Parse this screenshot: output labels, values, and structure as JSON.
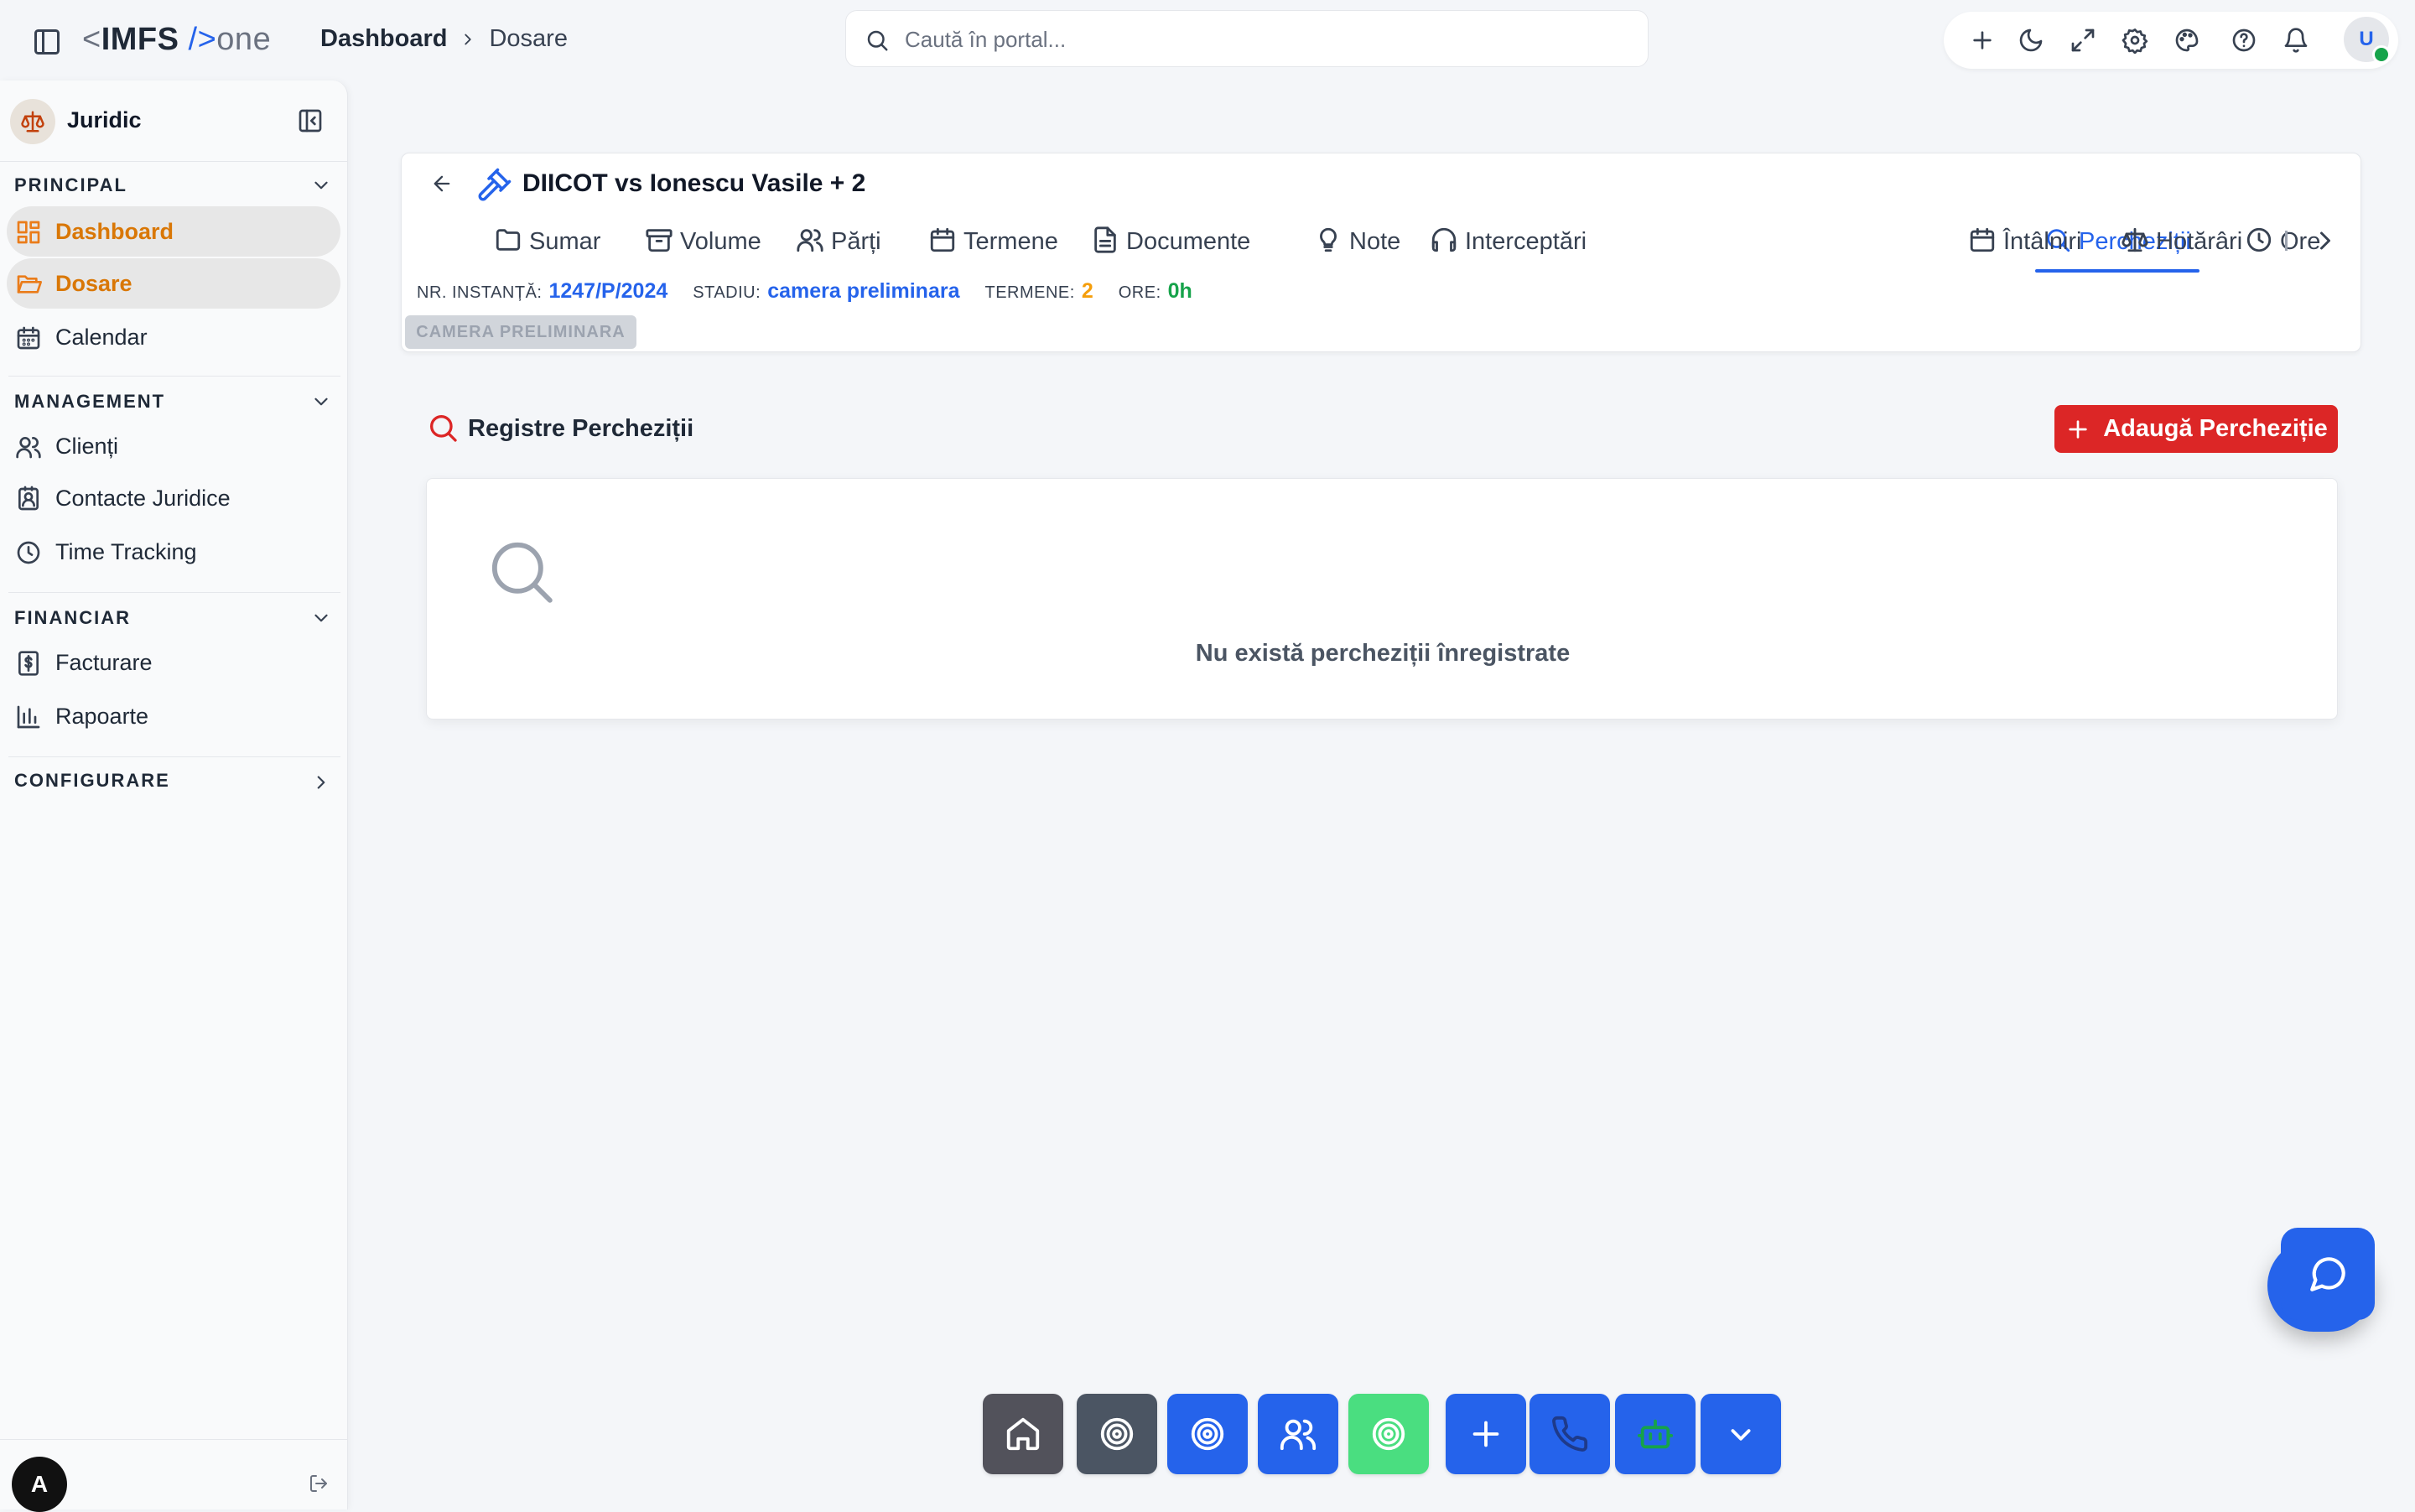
{
  "app": {
    "logo_lt": "<",
    "logo_name": "IMFS",
    "logo_slash": "/>",
    "logo_suffix": "one"
  },
  "breadcrumb": [
    "Dashboard",
    "Dosare"
  ],
  "search": {
    "placeholder": "Caută în portal..."
  },
  "topbar": {
    "icons": [
      "plus-icon",
      "moon-icon",
      "expand-icon",
      "gear-icon",
      "palette-icon",
      "help-icon",
      "bell-icon"
    ],
    "user_initial": "U",
    "user_status_color": "#16a34a"
  },
  "sidebar": {
    "title": "Juridic",
    "sections": [
      {
        "title": "PRINCIPAL",
        "expanded": true,
        "items": [
          {
            "label": "Dashboard",
            "icon": "dashboard-icon",
            "highlighted": true
          },
          {
            "label": "Dosare",
            "icon": "folder-open-icon",
            "highlighted": true
          },
          {
            "label": "Calendar",
            "icon": "calendar-icon",
            "highlighted": false
          }
        ]
      },
      {
        "title": "MANAGEMENT",
        "expanded": true,
        "items": [
          {
            "label": "Clienți",
            "icon": "users-icon"
          },
          {
            "label": "Contacte Juridice",
            "icon": "contact-book-icon"
          },
          {
            "label": "Time Tracking",
            "icon": "clock-icon"
          }
        ]
      },
      {
        "title": "FINANCIAR",
        "expanded": true,
        "items": [
          {
            "label": "Facturare",
            "icon": "invoice-icon"
          },
          {
            "label": "Rapoarte",
            "icon": "bar-chart-icon"
          }
        ]
      },
      {
        "title": "CONFIGURARE",
        "expanded": false,
        "items": []
      }
    ],
    "footer_initial": "A"
  },
  "case": {
    "title": "DIICOT vs Ionescu Vasile + 2",
    "tabs": [
      {
        "label": "Sumar",
        "icon": "folder-icon"
      },
      {
        "label": "Volume",
        "icon": "archive-icon"
      },
      {
        "label": "Părți",
        "icon": "users-icon"
      },
      {
        "label": "Termene",
        "icon": "calendar-icon"
      },
      {
        "label": "Documente",
        "icon": "document-icon"
      },
      {
        "label": "Note",
        "icon": "lightbulb-icon"
      },
      {
        "label": "Interceptări",
        "icon": "headphones-icon"
      },
      {
        "label": "Percheziții",
        "icon": "search-icon",
        "active": true
      },
      {
        "label": "Ore",
        "icon": "clock-icon"
      },
      {
        "label": "Întâlniri",
        "icon": "calendar-icon"
      },
      {
        "label": "Hotărâri",
        "icon": "scale-icon"
      }
    ],
    "meta": {
      "instance_label": "NR. INSTANȚĂ:",
      "instance_value": "1247/P/2024",
      "stage_label": "STADIU:",
      "stage_value": "camera preliminara",
      "deadlines_label": "TERMENE:",
      "deadlines_value": "2",
      "hours_label": "ORE:",
      "hours_value": "0h"
    },
    "stage_badge": "CAMERA PRELIMINARA"
  },
  "section": {
    "title": "Registre Percheziții",
    "add_button": "Adaugă Percheziție",
    "empty_text": "Nu există percheziții înregistrate"
  },
  "dock": {
    "buttons": [
      {
        "icon": "home-icon",
        "color": "#52525b"
      },
      {
        "icon": "target-icon",
        "color": "#4b5563"
      },
      {
        "icon": "target-icon",
        "color": "#2563eb"
      },
      {
        "icon": "users-icon",
        "color": "#2563eb"
      },
      {
        "icon": "target-icon",
        "color": "#4ade80"
      },
      {
        "icon": "plus-icon",
        "color": "#2563eb"
      },
      {
        "icon": "phone-icon",
        "color": "#2563eb"
      },
      {
        "icon": "bot-icon",
        "color": "#2563eb"
      },
      {
        "icon": "chevron-down-icon",
        "color": "#2563eb"
      }
    ]
  },
  "colors": {
    "accent": "#2563eb",
    "danger": "#dc2626",
    "active_nav": "#d97706",
    "deadlines": "#f59e0b",
    "hours": "#16a34a"
  }
}
